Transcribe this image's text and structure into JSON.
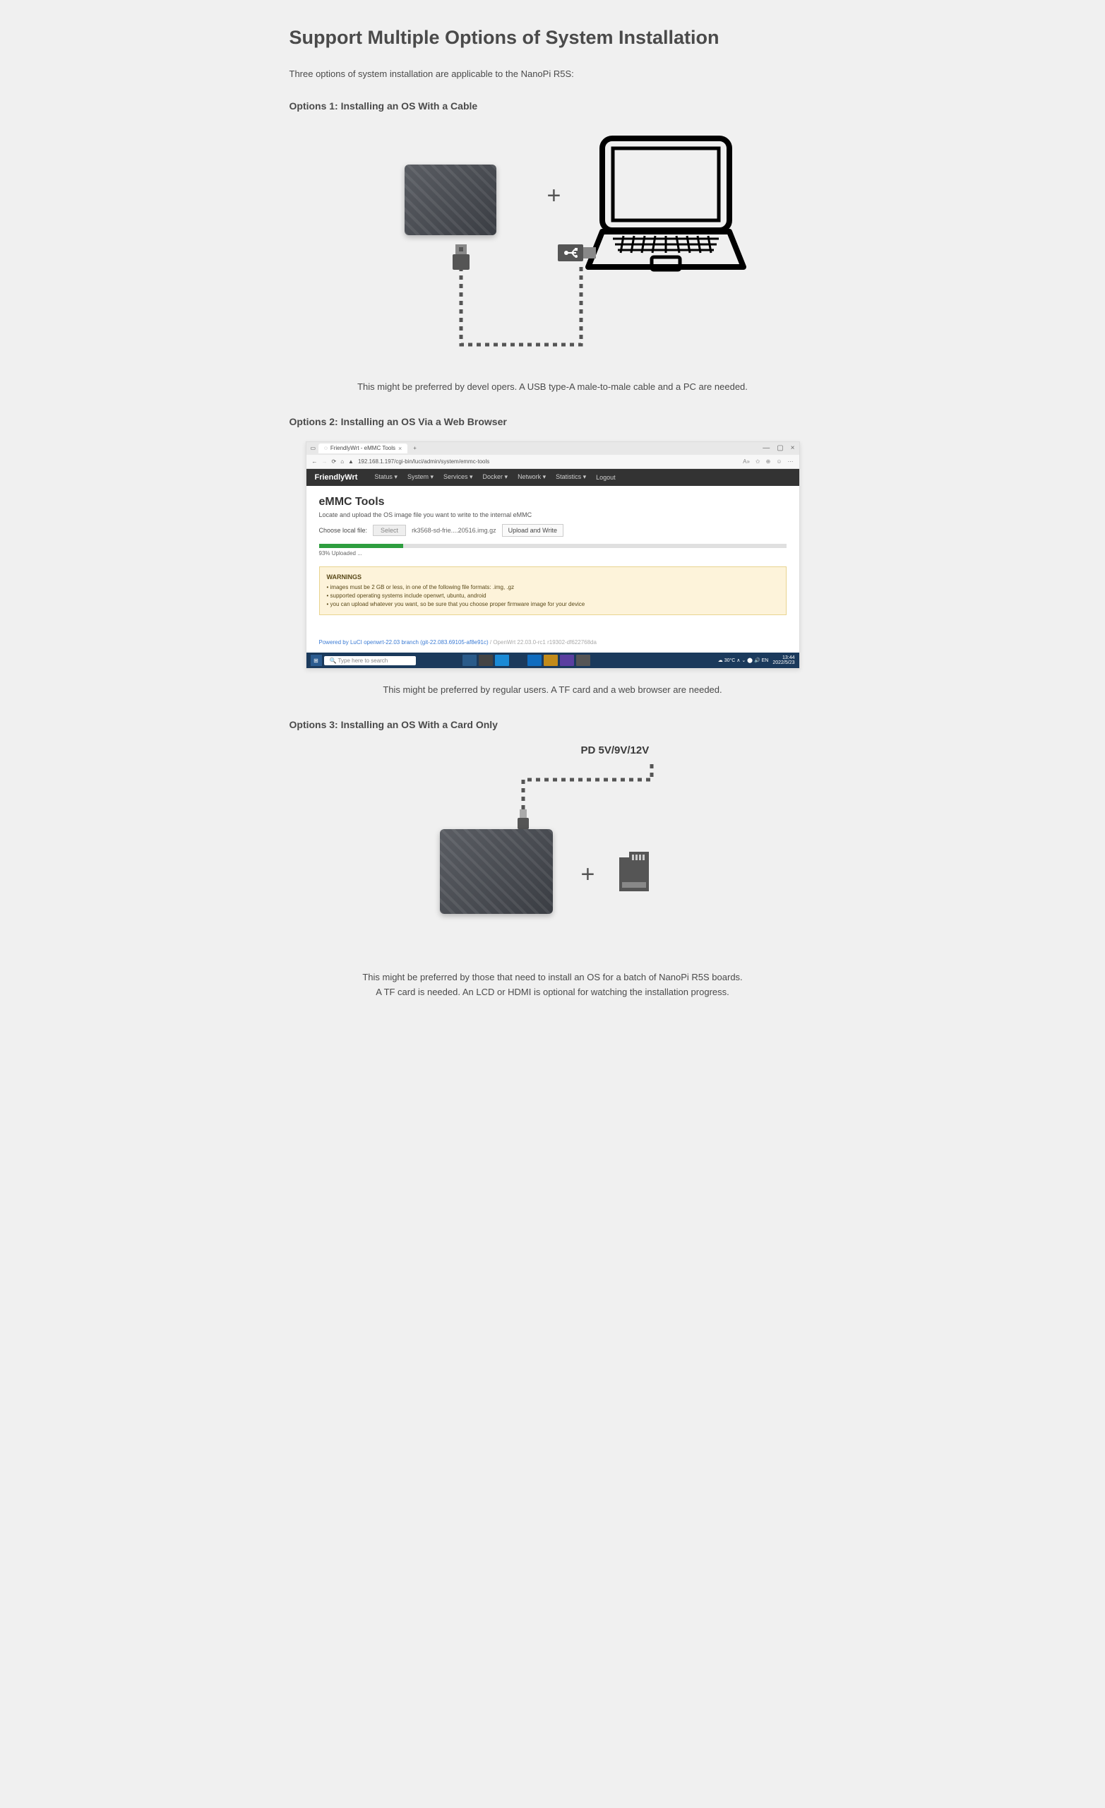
{
  "title": "Support Multiple Options of System Installation",
  "intro": "Three options of system installation are applicable to the NanoPi R5S:",
  "option1": {
    "heading": "Options 1: Installing an OS With a Cable",
    "caption": "This might be preferred by devel opers. A USB type-A male-to-male cable and a PC are needed."
  },
  "option2": {
    "heading": "Options 2: Installing an OS Via a Web Browser",
    "caption": "This might be preferred by regular users. A TF card and a web browser are needed.",
    "browser": {
      "tab_title": "FriendlyWrt - eMMC Tools",
      "url_lock": "▲",
      "url": "192.168.1.197/cgi-bin/luci/admin/system/emmc-tools",
      "brand": "FriendlyWrt",
      "menus": [
        "Status ▾",
        "System ▾",
        "Services ▾",
        "Docker ▾",
        "Network ▾",
        "Statistics ▾",
        "Logout"
      ],
      "page_title": "eMMC Tools",
      "page_sub": "Locate and upload the OS image file you want to write to the internal eMMC",
      "choose_label": "Choose local file:",
      "select_btn": "Select",
      "filename": "rk3568-sd-frie....20516.img.gz",
      "upload_btn": "Upload and Write",
      "progress_label": "93% Uploaded ...",
      "warn_title": "WARNINGS",
      "warn_items": [
        "• images must be 2 GB or less, in one of the following file formats: .img, .gz",
        "• supported operating systems include openwrt, ubuntu, android",
        "• you can upload whatever you want, so be sure that you choose proper firmware image for your device"
      ],
      "footer_a": "Powered by LuCI openwrt-22.03 branch (git-22.083.69105-af8e91c)",
      "footer_b": " / OpenWrt 22.03.0-rc1 r19302-df622768da",
      "taskbar_search": "Type here to search",
      "taskbar_weather": "☁ 30°C   ∧ ⌄ ⬤ 🔊 EN",
      "taskbar_time": "13:44",
      "taskbar_date": "2022/5/23"
    }
  },
  "option3": {
    "heading": "Options 3: Installing an OS With a Card Only",
    "pd_label": "PD 5V/9V/12V",
    "caption_line1": "This might be preferred by those that need to install an OS for a batch of NanoPi R5S boards.",
    "caption_line2": "A TF card is needed. An LCD or HDMI is optional for watching the installation progress."
  }
}
